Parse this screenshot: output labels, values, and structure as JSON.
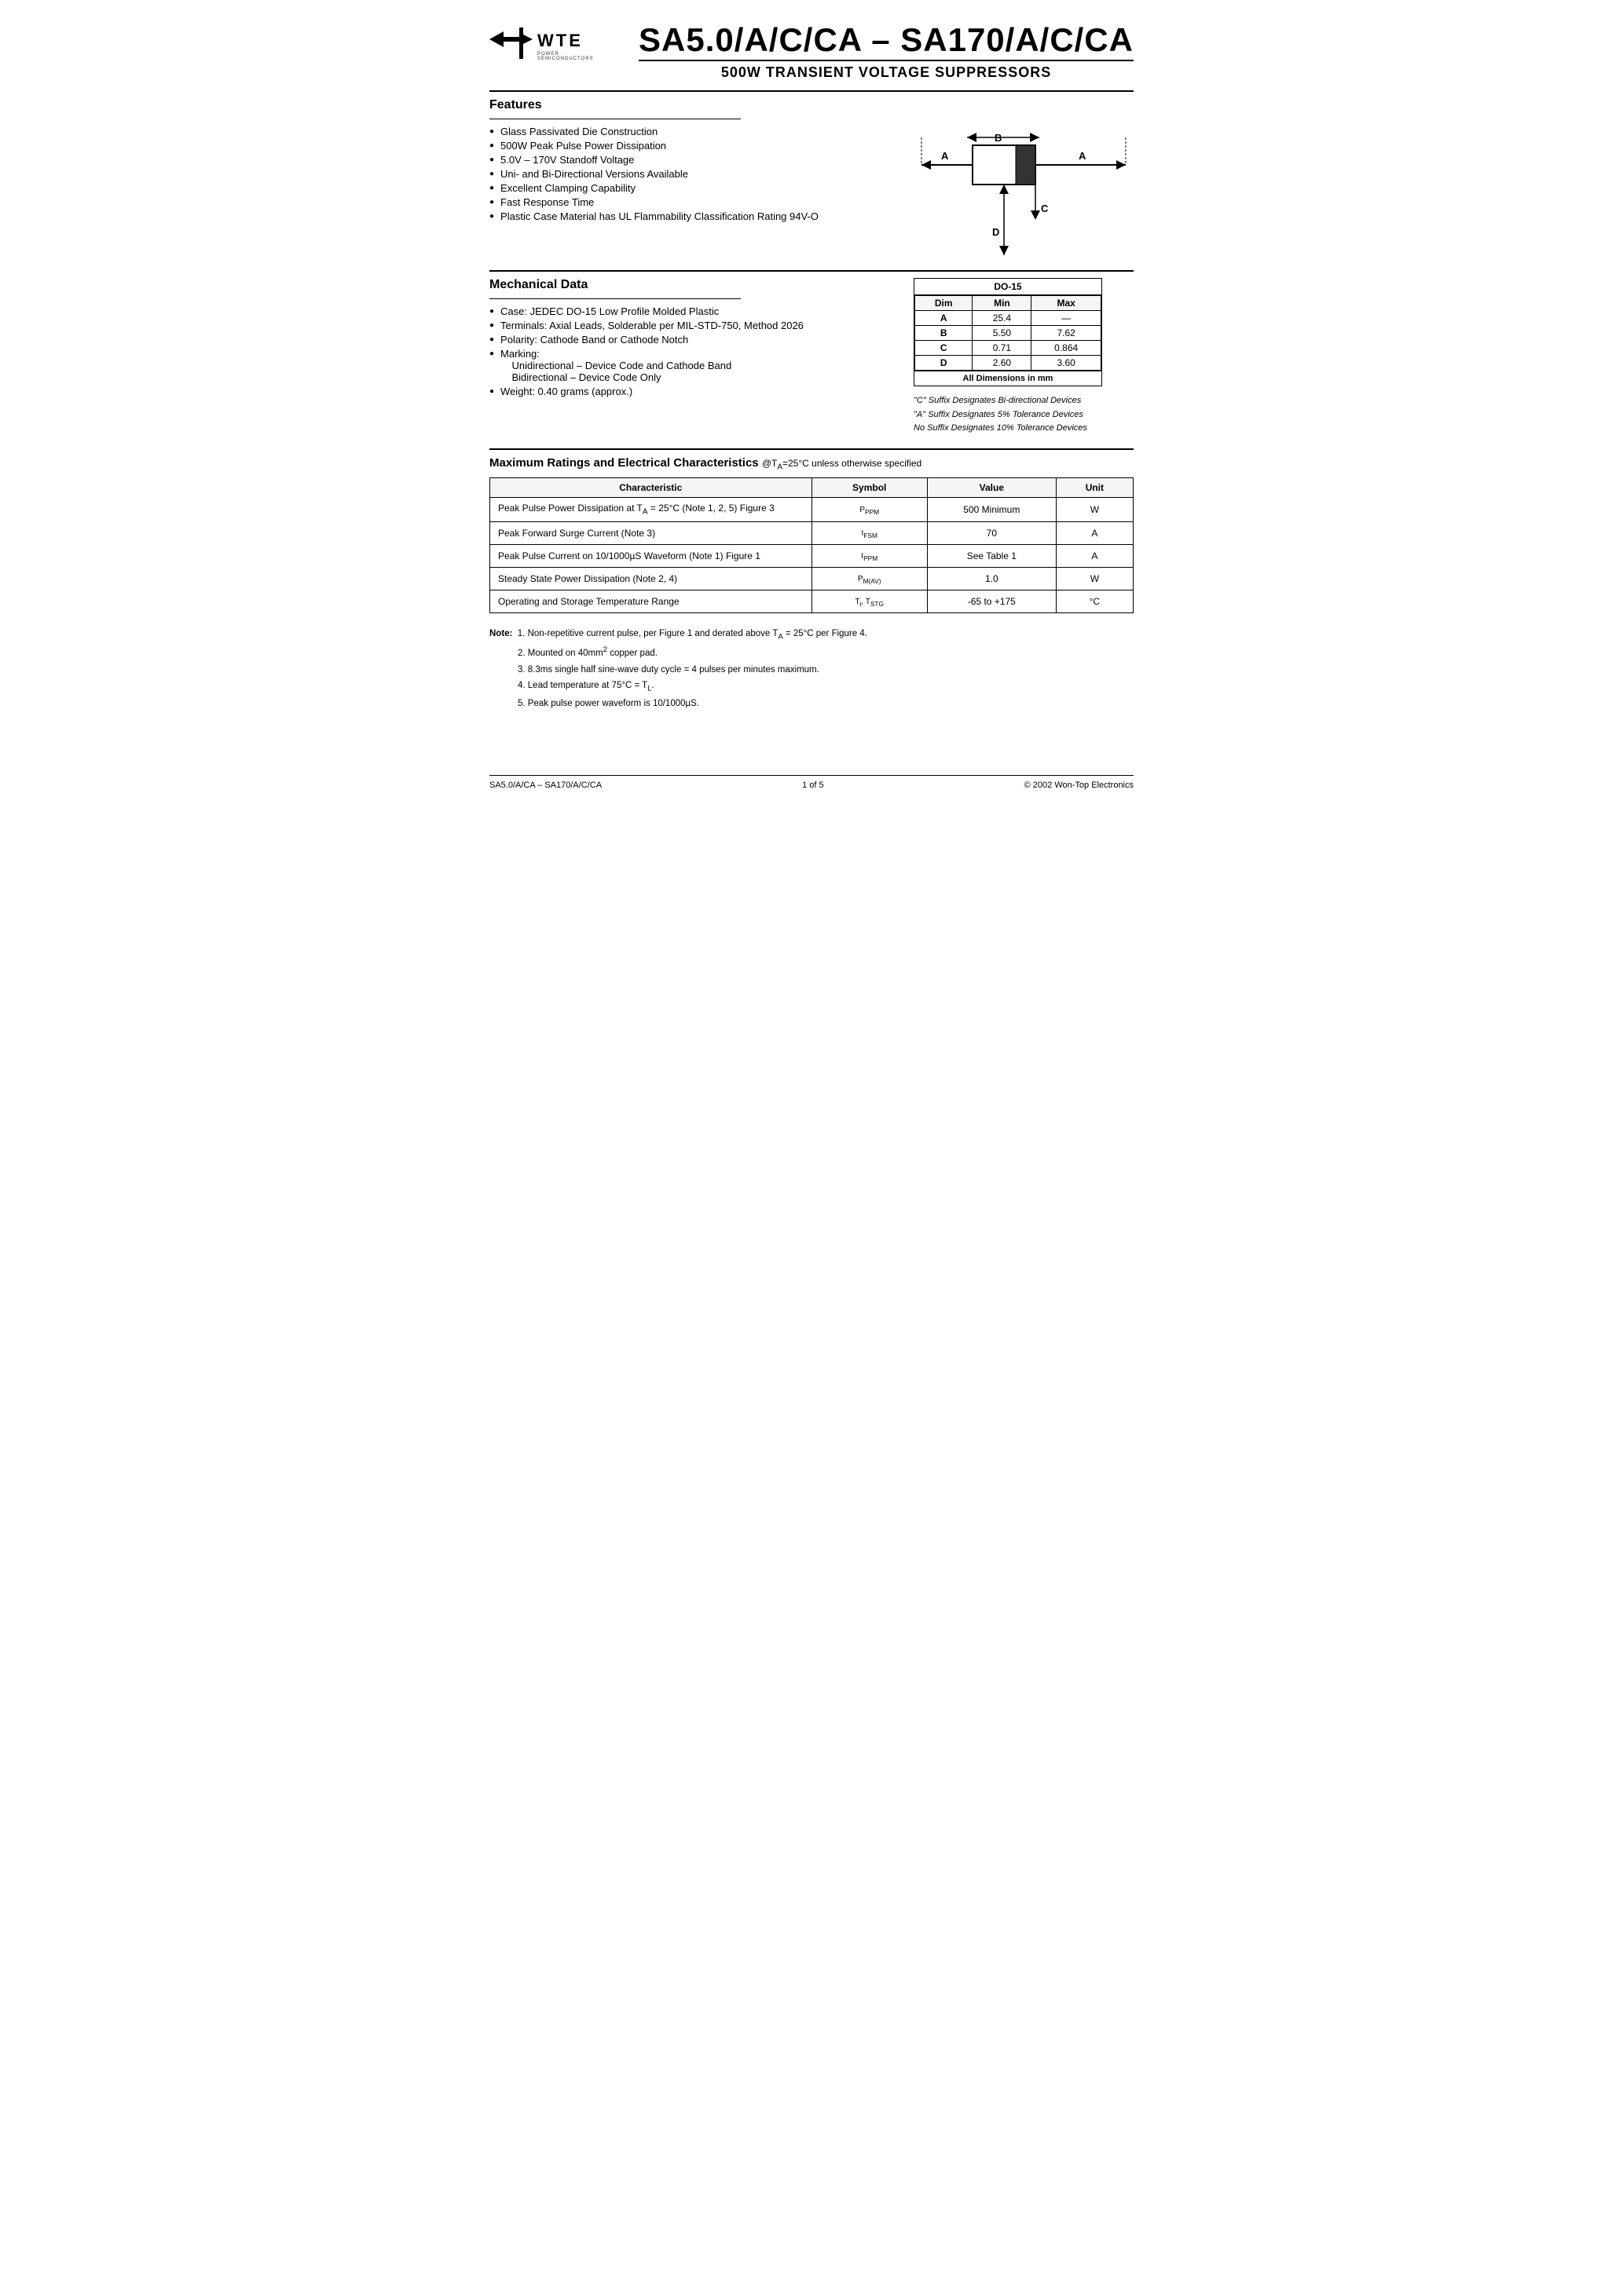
{
  "header": {
    "logo_wte": "WTE",
    "logo_sub": "POWER SEMICONDUCTORS",
    "main_title": "SA5.0/A/C/CA – SA170/A/C/CA",
    "sub_title": "500W TRANSIENT VOLTAGE SUPPRESSORS"
  },
  "features": {
    "heading": "Features",
    "items": [
      "Glass Passivated Die Construction",
      "500W Peak Pulse Power Dissipation",
      "5.0V – 170V Standoff Voltage",
      "Uni- and Bi-Directional Versions Available",
      "Excellent Clamping Capability",
      "Fast Response Time",
      "Plastic Case Material has UL Flammability Classification Rating 94V-O"
    ]
  },
  "mechanical": {
    "heading": "Mechanical Data",
    "items": [
      "Case: JEDEC DO-15 Low Profile Molded Plastic",
      "Terminals: Axial Leads, Solderable per MIL-STD-750, Method 2026",
      "Polarity: Cathode Band or Cathode Notch",
      "Marking:"
    ],
    "marking_lines": [
      "Unidirectional – Device Code and Cathode Band",
      "Bidirectional – Device Code Only"
    ],
    "weight": "Weight: 0.40 grams (approx.)"
  },
  "dimension_table": {
    "title": "DO-15",
    "headers": [
      "Dim",
      "Min",
      "Max"
    ],
    "rows": [
      [
        "A",
        "25.4",
        "—"
      ],
      [
        "B",
        "5.50",
        "7.62"
      ],
      [
        "C",
        "0.71",
        "0.864"
      ],
      [
        "D",
        "2.60",
        "3.60"
      ]
    ],
    "footer": "All Dimensions in mm"
  },
  "suffix_notes": [
    "\"C\" Suffix Designates Bi-directional Devices",
    "\"A\" Suffix Designates 5% Tolerance Devices",
    "No Suffix Designates 10% Tolerance Devices"
  ],
  "ratings": {
    "heading": "Maximum Ratings and Electrical Characteristics",
    "condition": "@Tₐ=25°C unless otherwise specified",
    "headers": [
      "Characteristic",
      "Symbol",
      "Value",
      "Unit"
    ],
    "rows": [
      {
        "char": "Peak Pulse Power Dissipation at Tₐ = 25°C (Note 1, 2, 5) Figure 3",
        "symbol": "PPPM",
        "value": "500 Minimum",
        "unit": "W"
      },
      {
        "char": "Peak Forward Surge Current (Note 3)",
        "symbol": "IFSM",
        "value": "70",
        "unit": "A"
      },
      {
        "char": "Peak Pulse Current on 10/1000µS Waveform (Note 1) Figure 1",
        "symbol": "IPPM",
        "value": "See Table 1",
        "unit": "A"
      },
      {
        "char": "Steady State Power Dissipation (Note 2, 4)",
        "symbol": "PM(AV)",
        "value": "1.0",
        "unit": "W"
      },
      {
        "char": "Operating and Storage Temperature Range",
        "symbol": "Ti, TSTG",
        "value": "-65 to +175",
        "unit": "°C"
      }
    ]
  },
  "notes": {
    "intro": "Note:",
    "items": [
      "1. Non-repetitive current pulse, per Figure 1 and derated above Tₐ = 25°C per Figure 4.",
      "2. Mounted on 40mm² copper pad.",
      "3. 8.3ms single half sine-wave duty cycle = 4 pulses per minutes maximum.",
      "4. Lead temperature at 75°C = Tₗ.",
      "5. Peak pulse power waveform is 10/1000µS."
    ]
  },
  "footer": {
    "left": "SA5.0/A/CA – SA170/A/C/CA",
    "center": "1 of 5",
    "right": "© 2002 Won-Top Electronics"
  }
}
